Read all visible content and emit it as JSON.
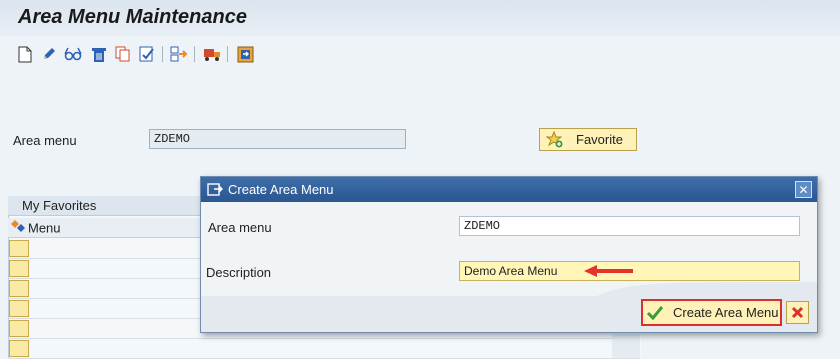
{
  "title": "Area Menu Maintenance",
  "toolbar": {
    "icons": [
      "new-document-icon",
      "edit-pencil-icon",
      "display-glasses-icon",
      "delete-trash-icon",
      "copy-icon",
      "check-icon",
      "transport-icon",
      "truck-icon",
      "export-icon"
    ]
  },
  "main": {
    "area_menu_label": "Area menu",
    "area_menu_value": "ZDEMO",
    "favorite_button": "Favorite"
  },
  "favorites": {
    "header": "My Favorites",
    "column": "Menu"
  },
  "dialog": {
    "title": "Create Area Menu",
    "area_menu_label": "Area menu",
    "area_menu_value": "ZDEMO",
    "description_label": "Description",
    "description_value": "Demo  Area Menu",
    "create_button": "Create Area Menu"
  },
  "colors": {
    "accent": "#2a5691",
    "button_fill": "#fff2b8",
    "highlight": "#d9302d"
  }
}
